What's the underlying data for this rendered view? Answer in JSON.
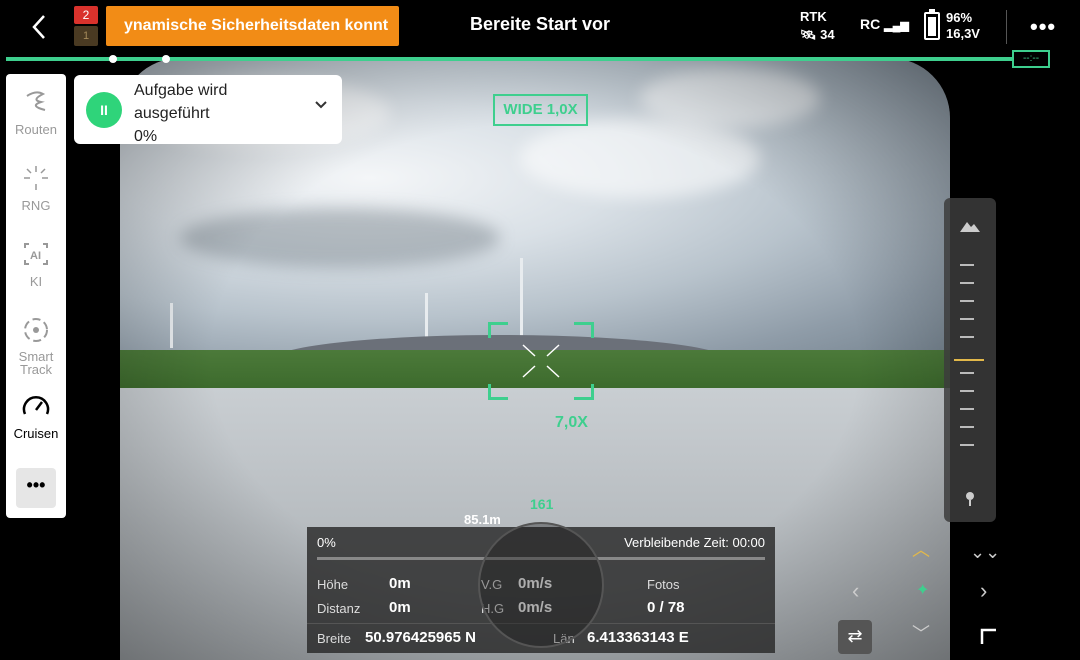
{
  "topbar": {
    "badge_count": "2",
    "badge_secondary": "1",
    "alert_text": "ynamische Sicherheitsdaten konnt",
    "title": "Bereite Start vor",
    "rtk_label": "RTK",
    "rtk_sats": "34",
    "rc_label": "RC",
    "battery_percent": "96%",
    "battery_voltage": "16,3V",
    "battery_level": 0.96
  },
  "sidebar": {
    "items": [
      {
        "label": "Routen",
        "icon": "route-icon"
      },
      {
        "label": "RNG",
        "icon": "rng-icon"
      },
      {
        "label": "KI",
        "icon": "ai-icon"
      },
      {
        "label": "Smart Track",
        "icon": "smart-track-icon"
      },
      {
        "label": "Cruisen",
        "icon": "speedometer-icon"
      }
    ],
    "more_label": "•••"
  },
  "task": {
    "title_line1": "Aufgabe wird",
    "title_line2": "ausgeführt",
    "progress": "0%"
  },
  "camera": {
    "lens_label": "WIDE  1,0X",
    "zoom_label": "7,0X"
  },
  "telemetry": {
    "progress": "0%",
    "remaining_time": "Verbleibende Zeit: 00:00",
    "height_label": "Höhe",
    "height_value": "0m",
    "distance_label": "Distanz",
    "distance_value": "0m",
    "vg_label": "V.G",
    "vg_value": "0m/s",
    "hg_label": "H.G",
    "hg_value": "0m/s",
    "photos_label": "Fotos",
    "photos_value": "0 / 78",
    "lat_label": "Breite",
    "lat_value": "50.976425965 N",
    "lon_label": "Län",
    "lon_value": "6.413363143 E",
    "heading": "161",
    "distance_marker": "85.1m"
  }
}
